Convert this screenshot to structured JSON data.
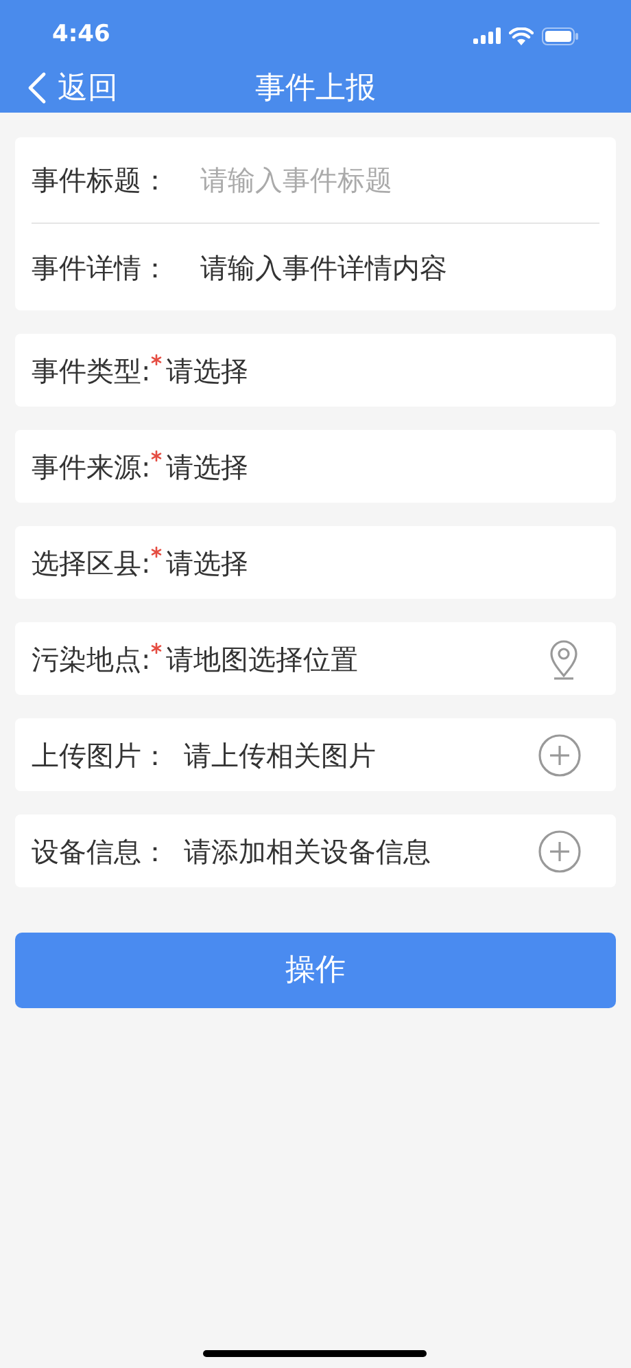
{
  "status_bar": {
    "time": "4:46"
  },
  "nav": {
    "back_label": "返回",
    "title": "事件上报"
  },
  "details_card": [
    {
      "kind": "input",
      "label": "事件标题：",
      "placeholder": "请输入事件标题"
    },
    {
      "kind": "textarea",
      "label": "事件详情：",
      "placeholder": "请输入事件详情内容"
    }
  ],
  "rows": [
    {
      "label": "事件类型:",
      "required": true,
      "hint": "请选择",
      "kind": "select"
    },
    {
      "label": "事件来源:",
      "required": true,
      "hint": "请选择",
      "kind": "select"
    },
    {
      "label": "选择区县:",
      "required": true,
      "hint": "请选择",
      "kind": "select"
    },
    {
      "label": "污染地点:",
      "required": true,
      "hint": "请地图选择位置",
      "kind": "location"
    },
    {
      "label": "上传图片：",
      "required": false,
      "hint": "请上传相关图片",
      "kind": "add"
    },
    {
      "label": "设备信息：",
      "required": false,
      "hint": "请添加相关设备信息",
      "kind": "add"
    }
  ],
  "submit_button": "操作"
}
